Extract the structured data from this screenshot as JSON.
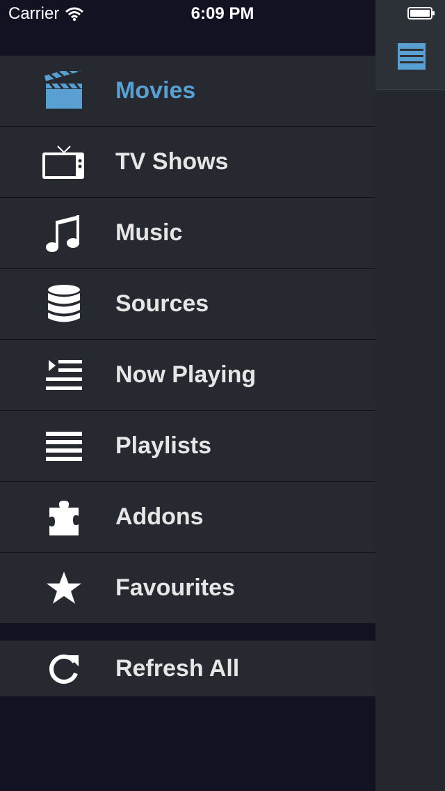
{
  "status_bar": {
    "carrier": "Carrier",
    "time": "6:09 PM"
  },
  "menu": {
    "items": [
      {
        "label": "Movies",
        "icon": "clapperboard-icon",
        "active": true
      },
      {
        "label": "TV Shows",
        "icon": "tv-icon",
        "active": false
      },
      {
        "label": "Music",
        "icon": "music-note-icon",
        "active": false
      },
      {
        "label": "Sources",
        "icon": "database-icon",
        "active": false
      },
      {
        "label": "Now Playing",
        "icon": "now-playing-icon",
        "active": false
      },
      {
        "label": "Playlists",
        "icon": "list-icon",
        "active": false
      },
      {
        "label": "Addons",
        "icon": "puzzle-icon",
        "active": false
      },
      {
        "label": "Favourites",
        "icon": "star-icon",
        "active": false
      }
    ],
    "refresh": {
      "label": "Refresh All",
      "icon": "refresh-icon"
    }
  },
  "colors": {
    "accent": "#5a9fd2",
    "row_background": "#262930",
    "background": "#121222",
    "text": "#e6e6e6"
  }
}
